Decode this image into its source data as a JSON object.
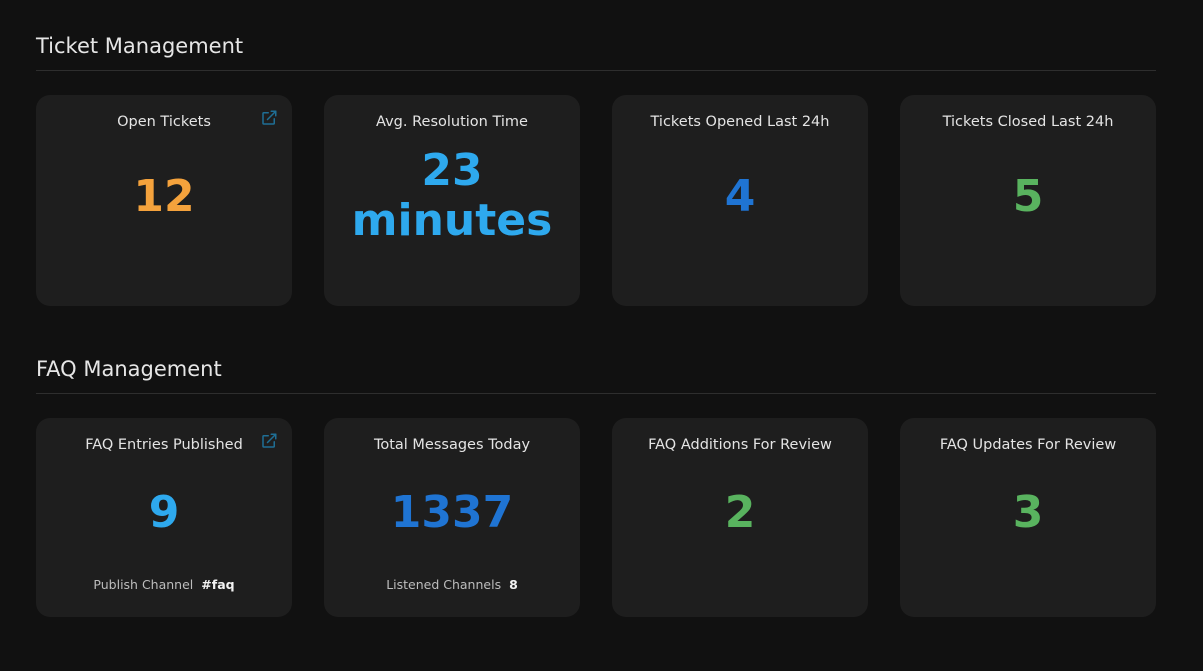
{
  "ticket_section": {
    "title": "Ticket Management",
    "cards": [
      {
        "title": "Open Tickets",
        "value": "12",
        "color": "#f4a23c",
        "icon": "external-link-icon"
      },
      {
        "title": "Avg. Resolution Time",
        "value_line1": "23",
        "value_line2": "minutes",
        "color": "#2ea9ee"
      },
      {
        "title": "Tickets Opened Last 24h",
        "value": "4",
        "color": "#1f74d3"
      },
      {
        "title": "Tickets Closed Last 24h",
        "value": "5",
        "color": "#59b35f"
      }
    ]
  },
  "faq_section": {
    "title": "FAQ Management",
    "cards": [
      {
        "title": "FAQ Entries Published",
        "value": "9",
        "color": "#2ea9ee",
        "icon": "external-link-icon",
        "footer_label": "Publish Channel",
        "footer_value": "#faq"
      },
      {
        "title": "Total Messages Today",
        "value": "1337",
        "color": "#1f74d3",
        "footer_label": "Listened Channels",
        "footer_value": "8"
      },
      {
        "title": "FAQ Additions For Review",
        "value": "2",
        "color": "#59b35f"
      },
      {
        "title": "FAQ Updates For Review",
        "value": "3",
        "color": "#59b35f"
      }
    ]
  }
}
